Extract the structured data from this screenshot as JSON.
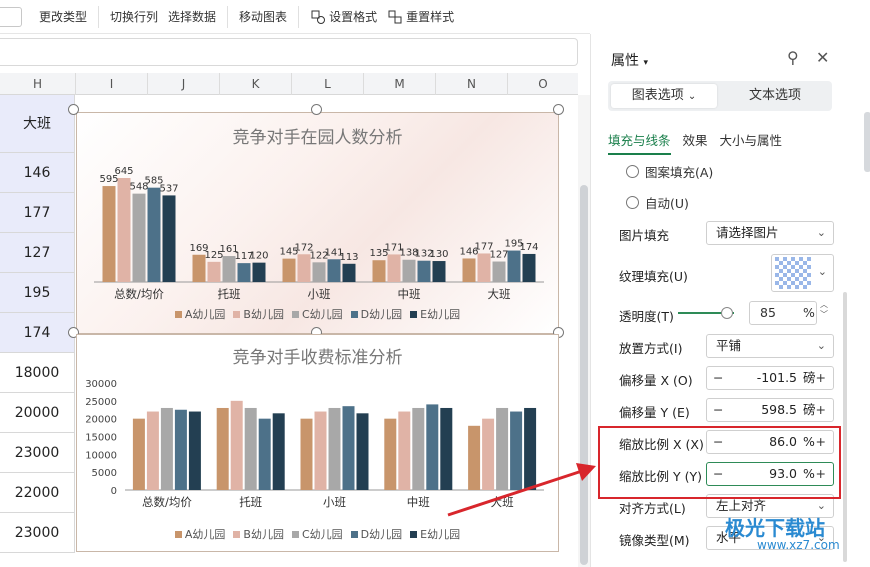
{
  "toolbar": {
    "change_type": "更改类型",
    "switch_rowcol": "切换行列",
    "select_data": "选择数据",
    "move_chart": "移动图表",
    "set_format": "设置格式",
    "reset_style": "重置样式"
  },
  "columns": [
    "H",
    "I",
    "J",
    "K",
    "L",
    "M",
    "N",
    "O"
  ],
  "h_column": [
    "大班",
    "146",
    "177",
    "127",
    "195",
    "174",
    "18000",
    "20000",
    "23000",
    "22000",
    "23000"
  ],
  "chart1": {
    "title": "竞争对手在园人数分析",
    "legend": [
      "A幼儿园",
      "B幼儿园",
      "C幼儿园",
      "D幼儿园",
      "E幼儿园"
    ]
  },
  "chart2": {
    "title": "竞争对手收费标准分析",
    "legend": [
      "A幼儿园",
      "B幼儿园",
      "C幼儿园",
      "D幼儿园",
      "E幼儿园"
    ]
  },
  "chart_data": [
    {
      "type": "bar",
      "title": "竞争对手在园人数分析",
      "categories": [
        "总数/均价",
        "托班",
        "小班",
        "中班",
        "大班"
      ],
      "series": [
        {
          "name": "A幼儿园",
          "values": [
            595,
            169,
            145,
            135,
            146
          ]
        },
        {
          "name": "B幼儿园",
          "values": [
            645,
            125,
            172,
            171,
            177
          ]
        },
        {
          "name": "C幼儿园",
          "values": [
            548,
            161,
            122,
            138,
            127
          ]
        },
        {
          "name": "D幼儿园",
          "values": [
            585,
            117,
            141,
            132,
            195
          ]
        },
        {
          "name": "E幼儿园",
          "values": [
            537,
            120,
            113,
            130,
            174
          ]
        }
      ],
      "colors": [
        "#c8956b",
        "#e0b3a6",
        "#a8a8a8",
        "#4d7189",
        "#233f52"
      ]
    },
    {
      "type": "bar",
      "title": "竞争对手收费标准分析",
      "categories": [
        "总数/均价",
        "托班",
        "小班",
        "中班",
        "大班"
      ],
      "yticks": [
        "0",
        "5000",
        "10000",
        "15000",
        "20000",
        "25000",
        "30000"
      ],
      "ylim": [
        0,
        30000
      ],
      "series": [
        {
          "name": "A幼儿园",
          "values": [
            20000,
            23000,
            20000,
            20000,
            18000
          ]
        },
        {
          "name": "B幼儿园",
          "values": [
            22000,
            25000,
            22000,
            22000,
            20000
          ]
        },
        {
          "name": "C幼儿园",
          "values": [
            23000,
            23000,
            23000,
            23000,
            23000
          ]
        },
        {
          "name": "D幼儿园",
          "values": [
            22500,
            20000,
            23500,
            24000,
            22000
          ]
        },
        {
          "name": "E幼儿园",
          "values": [
            22000,
            21500,
            21500,
            23000,
            23000
          ]
        }
      ],
      "colors": [
        "#c8956b",
        "#e0b3a6",
        "#a8a8a8",
        "#4d7189",
        "#233f52"
      ]
    }
  ],
  "panel": {
    "title": "属性",
    "tab_chart_options": "图表选项",
    "tab_text_options": "文本选项",
    "subtab_fill": "填充与线条",
    "subtab_effect": "效果",
    "subtab_size": "大小与属性",
    "radio_pattern": "图案填充(A)",
    "radio_auto": "自动(U)",
    "pic_fill_label": "图片填充",
    "pic_fill_value": "请选择图片",
    "texture_label": "纹理填充(U)",
    "transparency_label": "透明度(T)",
    "transparency_value": "85",
    "transparency_unit": "%",
    "placement_label": "放置方式(I)",
    "placement_value": "平铺",
    "offset_x_label": "偏移量 X (O)",
    "offset_x_value": "-101.5",
    "offset_x_unit": "磅",
    "offset_y_label": "偏移量 Y (E)",
    "offset_y_value": "598.5",
    "offset_y_unit": "磅",
    "scale_x_label": "缩放比例 X (X)",
    "scale_x_value": "86.0",
    "scale_x_unit": "%",
    "scale_y_label": "缩放比例 Y (Y)",
    "scale_y_value": "93.0",
    "scale_y_unit": "%",
    "align_label": "对齐方式(L)",
    "align_value": "左上对齐",
    "mirror_label": "镜像类型(M)",
    "mirror_value": "水平",
    "minus": "−",
    "plus": "+"
  },
  "watermark": {
    "name": "极光下载站",
    "url": "www.xz7.com"
  },
  "accent_color": "#1a7f4b",
  "highlight_color": "#d8262c"
}
